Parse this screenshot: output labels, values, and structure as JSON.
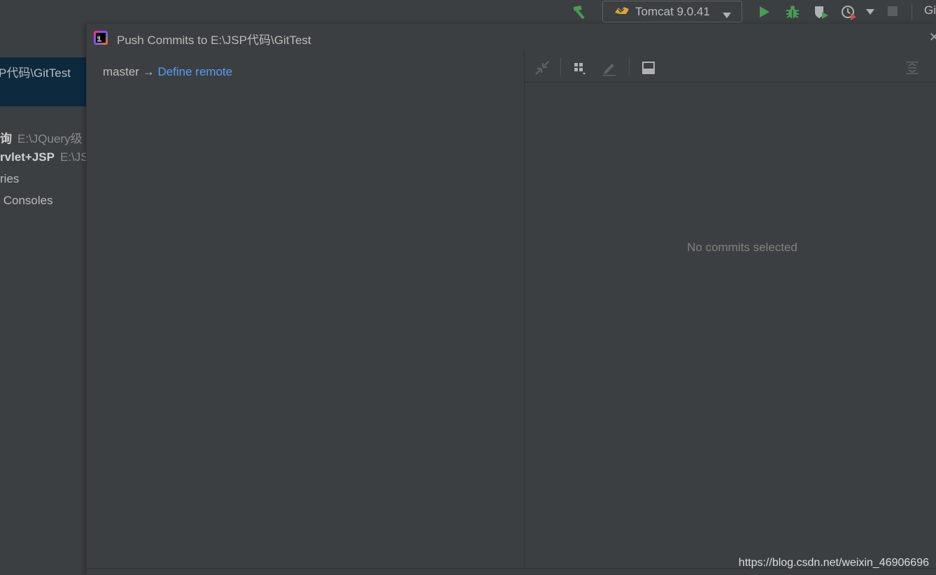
{
  "toolbar": {
    "build_icon": "hammer-icon",
    "run_config_label": "Tomcat 9.0.41",
    "run_config_icon": "tomcat-icon",
    "run_icon": "run-icon",
    "debug_icon": "debug-icon",
    "coverage_icon": "coverage-icon",
    "profile_icon": "profile-icon",
    "stop_icon": "stop-icon",
    "vcs_label": "Gi",
    "colors": {
      "run": "#499c54",
      "debug": "#499c54",
      "hammer": "#499c54"
    }
  },
  "project_tree": {
    "selected_item": "P代码\\GitTest",
    "items": [
      {
        "name": "询",
        "path": "E:\\JQuery级",
        "bold": true
      },
      {
        "name": "rvlet+JSP",
        "path": "E:\\JS",
        "bold": true
      },
      {
        "name": "ries",
        "path": "",
        "bold": false
      },
      {
        "name": " Consoles",
        "path": "",
        "bold": false
      }
    ]
  },
  "dialog": {
    "title": "Push Commits to E:\\JSP代码\\GitTest",
    "branch": "master",
    "arrow": "→",
    "define_remote_link": "Define remote",
    "details_toolbar": {
      "icons": [
        "collapse-icon",
        "group-by-icon",
        "edit-icon",
        "preview-icon",
        "expand-all-icon"
      ]
    },
    "empty_message": "No commits selected",
    "colors": {
      "link": "#589df6",
      "selection": "#0d293e"
    }
  },
  "watermark": "https://blog.csdn.net/weixin_46906696"
}
